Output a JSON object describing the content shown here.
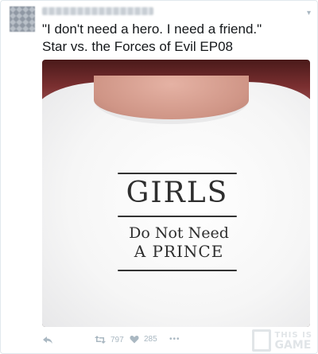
{
  "tweet": {
    "text_line1": "\"I don't need a hero. I need a friend.\"",
    "text_line2": "Star vs. the Forces of Evil EP08"
  },
  "photo": {
    "shirt_title": "GIRLS",
    "shirt_line2": "Do Not Need",
    "shirt_line3": "A PRINCE"
  },
  "actions": {
    "retweet_count": "797",
    "like_count": "285",
    "more_label": "•••"
  },
  "watermark": {
    "top": "THIS IS",
    "bottom": "GAME"
  },
  "colors": {
    "action_gray": "#aab8c2",
    "text": "#14171a"
  }
}
